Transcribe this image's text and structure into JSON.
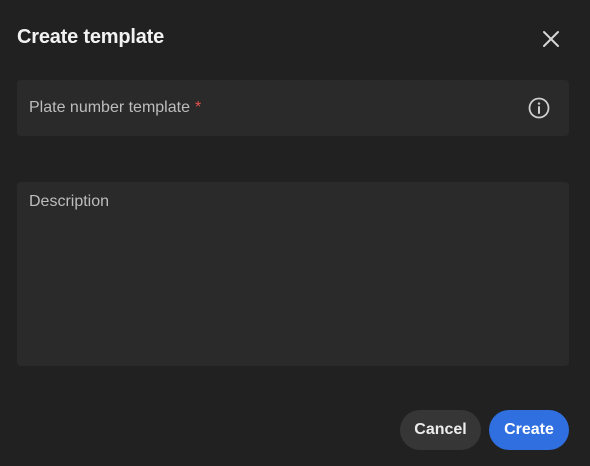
{
  "dialog": {
    "title": "Create template",
    "close_icon": "close-icon"
  },
  "fields": {
    "plate": {
      "label": "Plate number template",
      "required_marker": "*",
      "info_icon": "info-icon",
      "value": ""
    },
    "description": {
      "label": "Description",
      "value": ""
    }
  },
  "actions": {
    "cancel_label": "Cancel",
    "create_label": "Create"
  },
  "colors": {
    "background": "#212121",
    "field_background": "#2a2a2a",
    "primary": "#2f6fe0",
    "required": "#e5534b"
  }
}
